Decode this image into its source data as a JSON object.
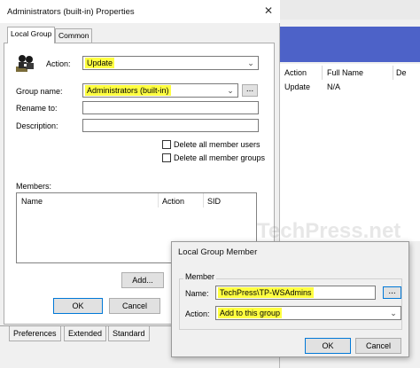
{
  "background_window": {
    "columns": [
      "Action",
      "Full Name",
      "De"
    ],
    "row": {
      "action": "Update",
      "full_name": "N/A"
    }
  },
  "dialog": {
    "title": "Administrators (built-in) Properties",
    "tabs": [
      "Local Group",
      "Common"
    ],
    "action_label": "Action:",
    "action_value": "Update",
    "group_name_label": "Group name:",
    "group_name_value": "Administrators (built-in)",
    "browse_label": "...",
    "rename_label": "Rename to:",
    "description_label": "Description:",
    "delete_users_label": "Delete all member users",
    "delete_groups_label": "Delete all member groups",
    "members_label": "Members:",
    "member_columns": [
      "Name",
      "Action",
      "SID"
    ],
    "add_label": "Add...",
    "ok_label": "OK",
    "cancel_label": "Cancel",
    "bottom_tabs": [
      "Preferences",
      "Extended",
      "Standard"
    ]
  },
  "member_dialog": {
    "title": "Local Group Member",
    "group_label": "Member",
    "name_label": "Name:",
    "name_value": "TechPress\\TP-WSAdmins",
    "browse_label": "...",
    "action_label": "Action:",
    "action_value": "Add to this group",
    "ok_label": "OK",
    "cancel_label": "Cancel"
  },
  "watermark": "TechPress.net",
  "colors": {
    "highlight": "#ffff40",
    "accent_band": "#4d62c8",
    "focus_border": "#0078d7"
  }
}
